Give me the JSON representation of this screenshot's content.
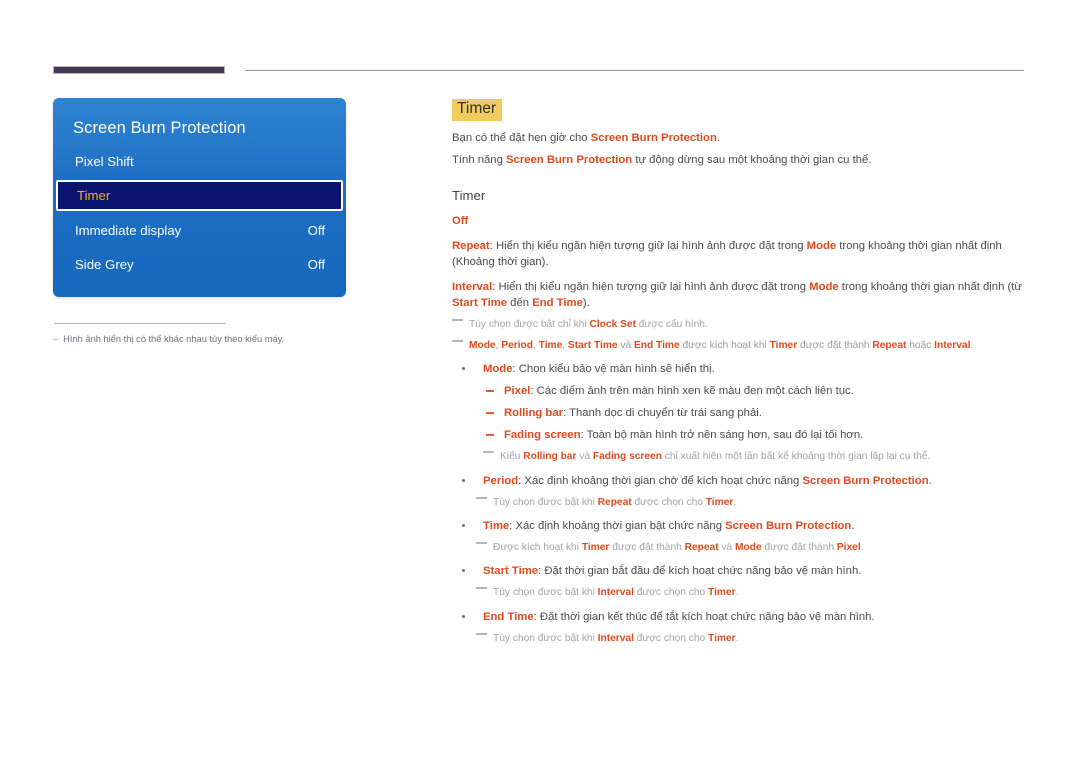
{
  "page": {
    "accent_keyword_color": "#e04a1e",
    "highlight_color": "#f0cb60",
    "osd_panel_color": "#1e6fc4",
    "osd_selected_bg": "#0a1470",
    "osd_selected_text": "#f0b323"
  },
  "osd": {
    "title": "Screen Burn Protection",
    "rows": [
      {
        "label": "Pixel Shift",
        "value": "",
        "selected": false
      },
      {
        "label": "Timer",
        "value": "",
        "selected": true
      },
      {
        "label": "Immediate display",
        "value": "Off",
        "selected": false
      },
      {
        "label": "Side Grey",
        "value": "Off",
        "selected": false
      }
    ],
    "footnote_dash": "–",
    "footnote": "Hình ảnh hiển thị có thể khác nhau tùy theo kiểu máy."
  },
  "content": {
    "heading": "Timer",
    "intro_1_a": "Bạn có thể đặt hẹn giờ cho ",
    "intro_1_kw": "Screen Burn Protection",
    "intro_1_b": ".",
    "intro_2_a": "Tính năng ",
    "intro_2_kw": "Screen Burn Protection",
    "intro_2_b": " tự động dừng sau một khoảng thời gian cụ thể.",
    "sub_heading": "Timer",
    "opt_off": "Off",
    "opt_repeat_kw": "Repeat",
    "opt_repeat_a": ": Hiển thị kiểu ngăn hiện tượng giữ lại hình ảnh được đặt trong ",
    "opt_repeat_kw2": "Mode",
    "opt_repeat_b": " trong khoảng thời gian nhất định (Khoảng thời gian).",
    "opt_interval_kw": "Interval",
    "opt_interval_a": ": Hiển thị kiểu ngăn hiện tượng giữ lại hình ảnh được đặt trong ",
    "opt_interval_kw2": "Mode",
    "opt_interval_b": " trong khoảng thời gian nhất định (từ ",
    "opt_interval_kw3": "Start Time",
    "opt_interval_c": " đến ",
    "opt_interval_kw4": "End Time",
    "opt_interval_d": ").",
    "note_clockset_a": "Tùy chọn được bật chỉ khi ",
    "note_clockset_kw": "Clock Set",
    "note_clockset_b": " được cấu hình.",
    "note_modes_kw1": "Mode",
    "note_modes_s1": ", ",
    "note_modes_kw2": "Period",
    "note_modes_s2": ", ",
    "note_modes_kw3": "Time",
    "note_modes_s3": ", ",
    "note_modes_kw4": "Start Time",
    "note_modes_s4": " và ",
    "note_modes_kw5": "End Time",
    "note_modes_s5": " được kích hoạt khi ",
    "note_modes_kw6": "Timer",
    "note_modes_s6": " được đặt thành ",
    "note_modes_kw7": "Repeat",
    "note_modes_s7": " hoặc ",
    "note_modes_kw8": "Interval",
    "note_modes_s8": ".",
    "b_mode_kw": "Mode",
    "b_mode_txt": ": Chọn kiểu bảo vệ màn hình sẽ hiển thị.",
    "sb_pixel_kw": "Pixel",
    "sb_pixel_txt": ": Các điểm ảnh trên màn hình xen kẽ màu đen một cách liên tục.",
    "sb_rolling_kw": "Rolling bar",
    "sb_rolling_txt": ": Thanh dọc di chuyển từ trái sang phải.",
    "sb_fading_kw": "Fading screen",
    "sb_fading_txt": ": Toàn bộ màn hình trở nên sáng hơn, sau đó lại tối hơn.",
    "note_kieu_a": "Kiểu ",
    "note_kieu_kw1": "Rolling bar",
    "note_kieu_b": " và ",
    "note_kieu_kw2": "Fading screen",
    "note_kieu_c": " chỉ xuất hiện một lần bất kể khoảng thời gian lặp lại cụ thể.",
    "b_period_kw": "Period",
    "b_period_a": ": Xác định khoảng thời gian chờ để kích hoạt chức năng ",
    "b_period_kw2": "Screen Burn Protection",
    "b_period_b": ".",
    "note_period_a": "Tùy chọn được bật khi ",
    "note_period_kw1": "Repeat",
    "note_period_b": " được chọn cho ",
    "note_period_kw2": "Timer",
    "note_period_c": ".",
    "b_time_kw": "Time",
    "b_time_a": ": Xác định khoảng thời gian bật chức năng ",
    "b_time_kw2": "Screen Burn Protection",
    "b_time_b": ".",
    "note_time_a": "Được kích hoạt khi ",
    "note_time_kw1": "Timer",
    "note_time_b": " được đặt thành ",
    "note_time_kw2": "Repeat",
    "note_time_c": " và ",
    "note_time_kw3": "Mode",
    "note_time_d": " được đặt thành ",
    "note_time_kw4": "Pixel",
    "note_time_e": ".",
    "b_start_kw": "Start Time",
    "b_start_txt": ": Đặt thời gian bắt đầu để kích hoạt chức năng bảo vệ màn hình.",
    "note_start_a": "Tùy chọn được bật khi ",
    "note_start_kw1": "Interval",
    "note_start_b": " được chọn cho ",
    "note_start_kw2": "Timer",
    "note_start_c": ".",
    "b_end_kw": "End Time",
    "b_end_txt": ": Đặt thời gian kết thúc để tắt kích hoạt chức năng bảo vệ màn hình.",
    "note_end_a": "Tùy chọn được bật khi ",
    "note_end_kw1": "Interval",
    "note_end_b": " được chọn cho ",
    "note_end_kw2": "Timer",
    "note_end_c": "."
  }
}
